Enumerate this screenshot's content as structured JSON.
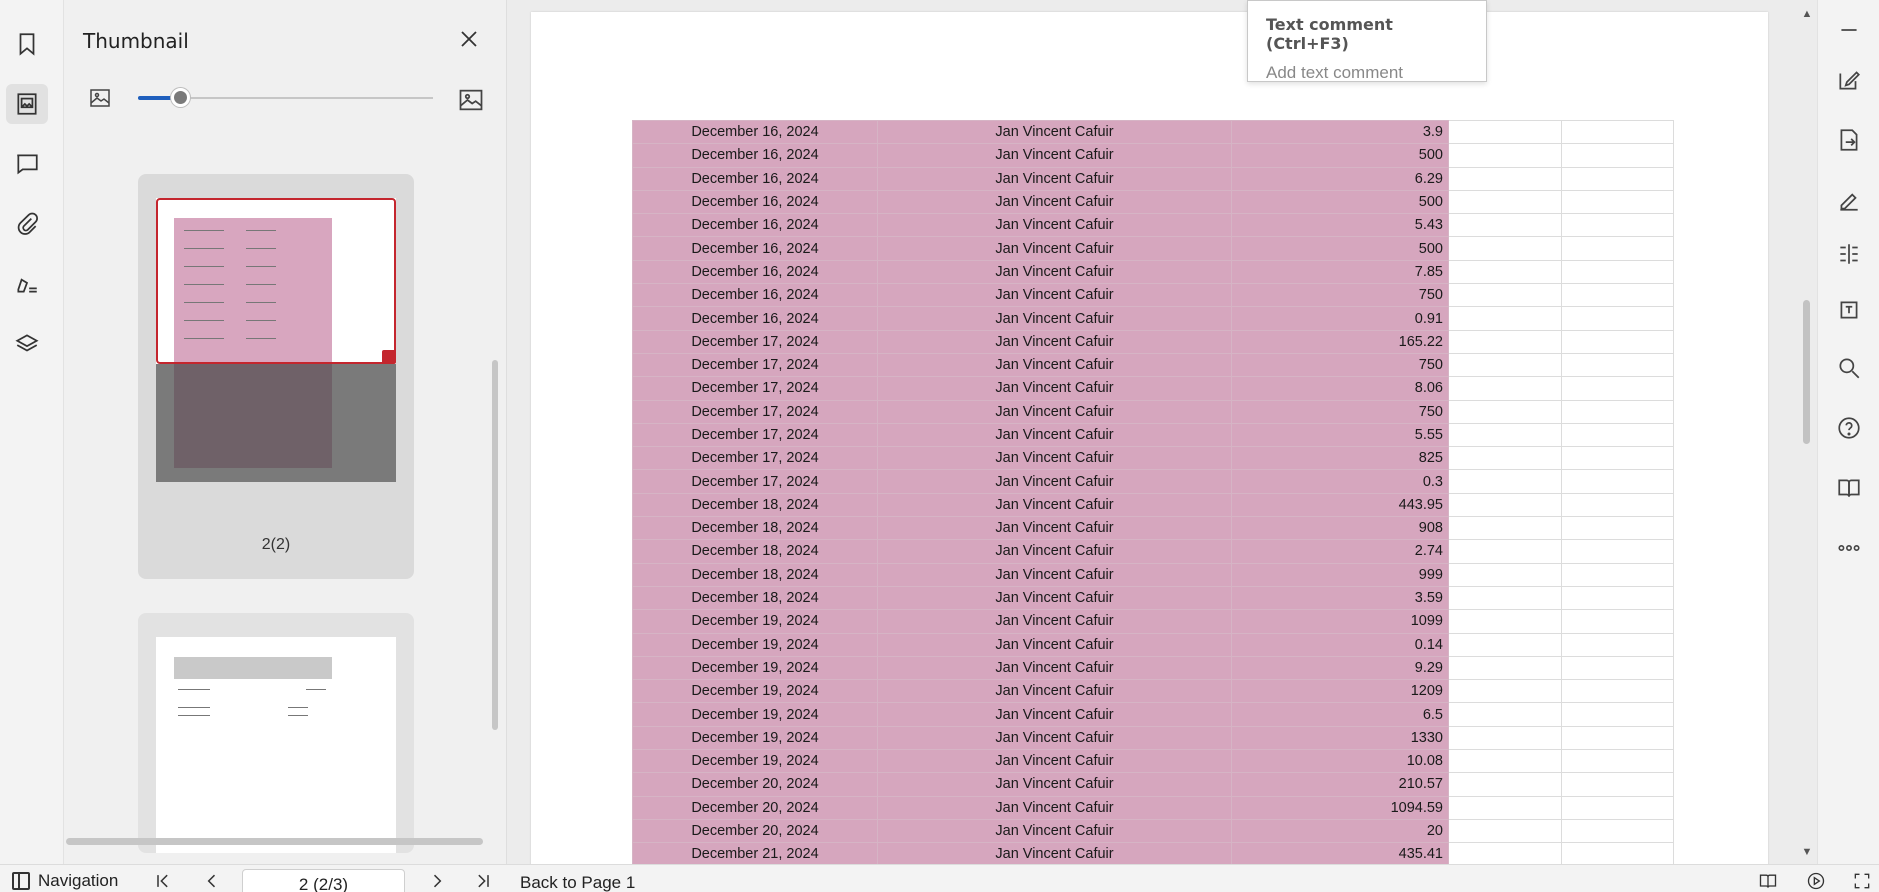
{
  "thumbnail_panel": {
    "title": "Thumbnail",
    "pages": [
      {
        "label": "2(2)"
      },
      {
        "label": ""
      }
    ],
    "zoom_level": 0.12
  },
  "tooltip": {
    "title": "Text comment (Ctrl+F3)",
    "subtitle": "Add text comment"
  },
  "highlight_color": "#d6a6be",
  "rows": [
    {
      "date": "December 16, 2024",
      "name": "Jan Vincent Cafuir",
      "amount": "3.9"
    },
    {
      "date": "December 16, 2024",
      "name": "Jan Vincent Cafuir",
      "amount": "500"
    },
    {
      "date": "December 16, 2024",
      "name": "Jan Vincent Cafuir",
      "amount": "6.29"
    },
    {
      "date": "December 16, 2024",
      "name": "Jan Vincent Cafuir",
      "amount": "500"
    },
    {
      "date": "December 16, 2024",
      "name": "Jan Vincent Cafuir",
      "amount": "5.43"
    },
    {
      "date": "December 16, 2024",
      "name": "Jan Vincent Cafuir",
      "amount": "500"
    },
    {
      "date": "December 16, 2024",
      "name": "Jan Vincent Cafuir",
      "amount": "7.85"
    },
    {
      "date": "December 16, 2024",
      "name": "Jan Vincent Cafuir",
      "amount": "750"
    },
    {
      "date": "December 16, 2024",
      "name": "Jan Vincent Cafuir",
      "amount": "0.91"
    },
    {
      "date": "December 17, 2024",
      "name": "Jan Vincent Cafuir",
      "amount": "165.22"
    },
    {
      "date": "December 17, 2024",
      "name": "Jan Vincent Cafuir",
      "amount": "750"
    },
    {
      "date": "December 17, 2024",
      "name": "Jan Vincent Cafuir",
      "amount": "8.06"
    },
    {
      "date": "December 17, 2024",
      "name": "Jan Vincent Cafuir",
      "amount": "750"
    },
    {
      "date": "December 17, 2024",
      "name": "Jan Vincent Cafuir",
      "amount": "5.55"
    },
    {
      "date": "December 17, 2024",
      "name": "Jan Vincent Cafuir",
      "amount": "825"
    },
    {
      "date": "December 17, 2024",
      "name": "Jan Vincent Cafuir",
      "amount": "0.3"
    },
    {
      "date": "December 18, 2024",
      "name": "Jan Vincent Cafuir",
      "amount": "443.95"
    },
    {
      "date": "December 18, 2024",
      "name": "Jan Vincent Cafuir",
      "amount": "908"
    },
    {
      "date": "December 18, 2024",
      "name": "Jan Vincent Cafuir",
      "amount": "2.74"
    },
    {
      "date": "December 18, 2024",
      "name": "Jan Vincent Cafuir",
      "amount": "999"
    },
    {
      "date": "December 18, 2024",
      "name": "Jan Vincent Cafuir",
      "amount": "3.59"
    },
    {
      "date": "December 19, 2024",
      "name": "Jan Vincent Cafuir",
      "amount": "1099"
    },
    {
      "date": "December 19, 2024",
      "name": "Jan Vincent Cafuir",
      "amount": "0.14"
    },
    {
      "date": "December 19, 2024",
      "name": "Jan Vincent Cafuir",
      "amount": "9.29"
    },
    {
      "date": "December 19, 2024",
      "name": "Jan Vincent Cafuir",
      "amount": "1209"
    },
    {
      "date": "December 19, 2024",
      "name": "Jan Vincent Cafuir",
      "amount": "6.5"
    },
    {
      "date": "December 19, 2024",
      "name": "Jan Vincent Cafuir",
      "amount": "1330"
    },
    {
      "date": "December 19, 2024",
      "name": "Jan Vincent Cafuir",
      "amount": "10.08"
    },
    {
      "date": "December 20, 2024",
      "name": "Jan Vincent Cafuir",
      "amount": "210.57"
    },
    {
      "date": "December 20, 2024",
      "name": "Jan Vincent Cafuir",
      "amount": "1094.59"
    },
    {
      "date": "December 20, 2024",
      "name": "Jan Vincent Cafuir",
      "amount": "20"
    },
    {
      "date": "December 21, 2024",
      "name": "Jan Vincent Cafuir",
      "amount": "435.41"
    }
  ],
  "left_rail": {
    "icons": [
      "bookmark-icon",
      "thumbnail-icon",
      "comment-icon",
      "attachment-icon",
      "signature-icon",
      "layers-icon"
    ]
  },
  "right_rail": {
    "icons": [
      "minimize-icon",
      "edit-icon",
      "export-icon",
      "sign-icon",
      "compare-icon",
      "translate-icon",
      "search-icon",
      "help-icon",
      "read-aloud-icon",
      "more-icon"
    ]
  },
  "bottom_bar": {
    "navigation_label": "Navigation",
    "page_value": "2 (2/3)",
    "back_label": "Back to Page 1"
  }
}
